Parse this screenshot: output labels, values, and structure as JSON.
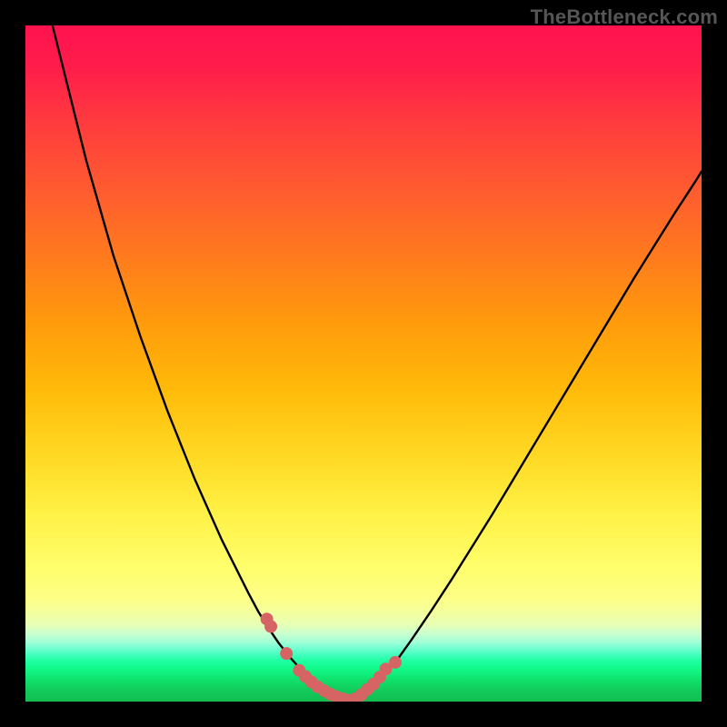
{
  "watermark": "TheBottleneck.com",
  "chart_data": {
    "type": "line",
    "title": "",
    "xlabel": "",
    "ylabel": "",
    "xlim": [
      0,
      100
    ],
    "ylim": [
      0,
      100
    ],
    "series": [
      {
        "name": "left-branch",
        "x": [
          4,
          5,
          7,
          9,
          11,
          13,
          15,
          17,
          19,
          21,
          23,
          25,
          27,
          29,
          31,
          33,
          34.5,
          36,
          37.5,
          39,
          40.5,
          42,
          43,
          44,
          45,
          46
        ],
        "y": [
          100,
          96,
          88,
          80,
          73,
          66,
          60,
          54,
          48.5,
          43,
          38,
          33,
          28.5,
          24,
          20,
          16,
          13.2,
          10.8,
          8.6,
          6.7,
          5.0,
          3.6,
          2.5,
          1.6,
          0.9,
          0.5
        ]
      },
      {
        "name": "valley",
        "x": [
          46,
          47,
          48,
          49
        ],
        "y": [
          0.5,
          0.1,
          0.1,
          0.5
        ]
      },
      {
        "name": "right-branch",
        "x": [
          49,
          50,
          51.5,
          53,
          55,
          57,
          60,
          63,
          66,
          69,
          72,
          75,
          78,
          81,
          84,
          87,
          90,
          93,
          96,
          99,
          100
        ],
        "y": [
          0.5,
          1.2,
          2.4,
          3.8,
          6.2,
          9.0,
          13.4,
          18.0,
          22.8,
          27.6,
          32.6,
          37.6,
          42.6,
          47.6,
          52.6,
          57.6,
          62.6,
          67.4,
          72.2,
          76.8,
          78.4
        ]
      },
      {
        "name": "left-dots",
        "type": "scatter",
        "x": [
          35.7,
          36.3,
          38.6,
          40.5,
          41.4,
          42.3,
          43.2,
          44.2,
          45.1,
          46.0,
          47.0,
          47.9
        ],
        "y": [
          12.2,
          11.1,
          7.1,
          4.6,
          3.7,
          2.9,
          2.2,
          1.6,
          1.1,
          0.7,
          0.4,
          0.2
        ]
      },
      {
        "name": "right-dots",
        "type": "scatter",
        "x": [
          48.8,
          49.7,
          50.6,
          51.5,
          52.4,
          53.3,
          54.7
        ],
        "y": [
          0.4,
          1.0,
          1.8,
          2.6,
          3.6,
          4.8,
          5.8
        ]
      }
    ],
    "dot_color": "#d76464",
    "dot_radius_px": 7
  }
}
